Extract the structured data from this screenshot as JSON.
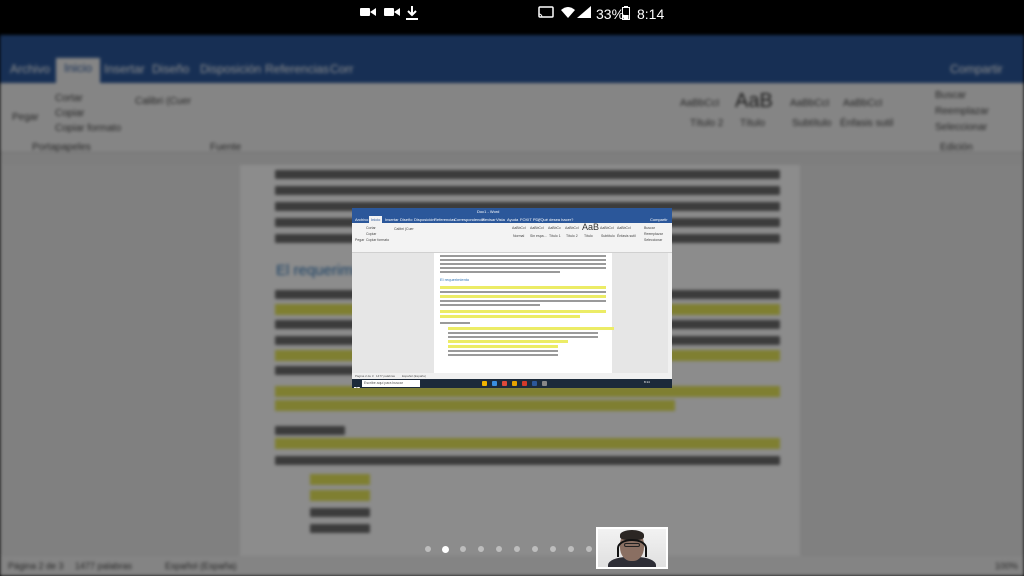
{
  "phone_status": {
    "battery": "33%",
    "time": "8:14",
    "icons": [
      "video-camera-icon",
      "video-camera-icon",
      "download-icon",
      "cast-icon",
      "wifi-icon",
      "signal-icon",
      "battery-icon"
    ]
  },
  "background": {
    "tabs": [
      "Archivo",
      "Inicio",
      "Insertar",
      "Diseño",
      "Disposición",
      "Referencias",
      "Corr"
    ],
    "ribbon": {
      "paste": "Pegar",
      "cut": "Cortar",
      "copy": "Copiar",
      "format_painter": "Copiar formato",
      "clipboard": "Portapapeles",
      "font": "Fuente",
      "font_name": "Calibri (Cuer",
      "styles": [
        "AaBbCcI",
        "AaB",
        "AaBbCcI",
        "AaBbCcI"
      ],
      "style_names": [
        "Título 2",
        "Título",
        "Subtítulo",
        "Énfasis sutil"
      ],
      "find": "Buscar",
      "replace": "Reemplazar",
      "select": "Seleccionar",
      "editing": "Edición",
      "share": "Compartir"
    },
    "heading": "El requerimi",
    "status": {
      "page": "Página 2 de 3",
      "words": "1477 palabras",
      "language": "Español (España)",
      "zoom": "100%"
    }
  },
  "screenshot": {
    "title": "Doc1 - Word",
    "tabs": [
      "Archivo",
      "Inicio",
      "Insertar",
      "Diseño",
      "Disposición",
      "Referencias",
      "Correspondencia",
      "Revisar",
      "Vista",
      "Ayuda",
      "FOXIT PDF",
      "¿Qué desea hacer?"
    ],
    "share": "Compartir",
    "ribbon": {
      "paste": "Pegar",
      "cut": "Cortar",
      "copy": "Copiar",
      "format_painter": "Copiar formato",
      "font_name": "Calibri (Cuer",
      "styles": [
        "AaBbCcI",
        "AaBbCcI",
        "AaBbCc",
        "AaBbCcI",
        "AaB",
        "AaBbCcI",
        "AaBbCcI"
      ],
      "style_names": [
        "Normal",
        "Sin espa...",
        "Título 1",
        "Título 2",
        "Título",
        "Subtítulo",
        "Énfasis sutil"
      ],
      "find": "Buscar",
      "replace": "Reemplazar",
      "select": "Seleccionar"
    },
    "heading": "El requerimiento",
    "status": {
      "page": "Página 2 de 3",
      "words": "1477 palabras",
      "language": "Español (España)"
    },
    "taskbar": {
      "search_placeholder": "Escribe aquí para buscar",
      "time": "8:14"
    }
  },
  "page_indicator": {
    "count": 10,
    "active_index": 1
  }
}
